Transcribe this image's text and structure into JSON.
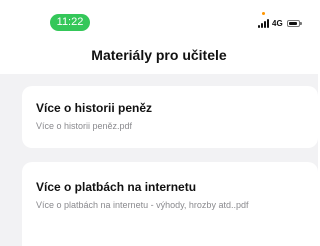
{
  "status_bar": {
    "time": "11:22",
    "network": "4G",
    "accent_color": "#34c759"
  },
  "header": {
    "title": "Materiály pro učitele"
  },
  "materials": [
    {
      "title": "Více o historii peněz",
      "file": "Více o historii peněz.pdf"
    },
    {
      "title": "Více o platbách na internetu",
      "file": "Více o platbách na internetu - výhody, hrozby atd..pdf"
    }
  ]
}
